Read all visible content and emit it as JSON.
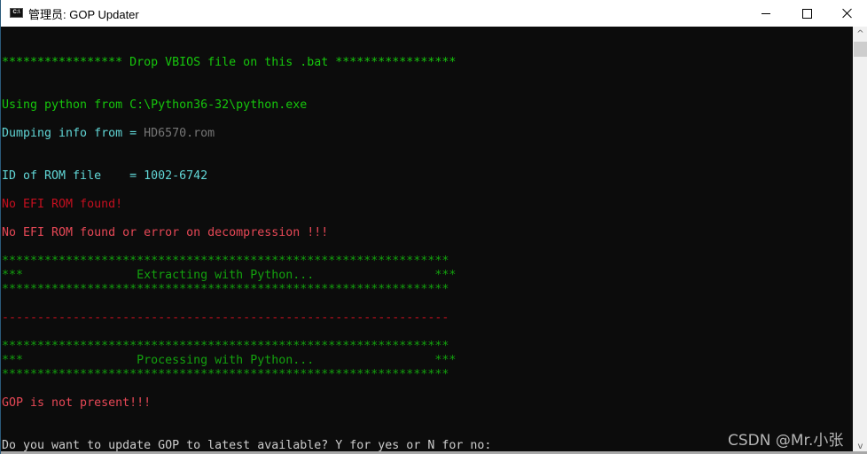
{
  "window": {
    "title": "管理员:  GOP Updater",
    "icon": "console-icon",
    "icon_text": "C:\\",
    "controls": {
      "minimize": "minimize-icon",
      "maximize": "maximize-icon",
      "close": "close-icon"
    }
  },
  "console": {
    "lines": [
      {
        "text": "***************** Drop VBIOS file on this .bat *****************",
        "color": "green-bright"
      },
      {
        "text": "Using python from C:\\Python36-32\\python.exe",
        "color": "green-bright"
      },
      {
        "text_label": "Dumping info from = ",
        "text_value": "HD6570.rom"
      },
      {
        "text": "ID of ROM file    = 1002-6742",
        "color": "cyan"
      },
      {
        "text": "No EFI ROM found!",
        "color": "darkred"
      },
      {
        "text": "No EFI ROM found or error on decompression !!!",
        "color": "red"
      },
      {
        "text": "***************************************************************",
        "color": "green"
      },
      {
        "text": "***                Extracting with Python...                 ***",
        "color": "green"
      },
      {
        "text": "***************************************************************",
        "color": "green"
      },
      {
        "text": "---------------------------------------------------------------",
        "color": "darkred"
      },
      {
        "text": "***************************************************************",
        "color": "green"
      },
      {
        "text": "***                Processing with Python...                 ***",
        "color": "green"
      },
      {
        "text": "***************************************************************",
        "color": "green"
      },
      {
        "text": "GOP is not present!!!",
        "color": "red"
      },
      {
        "text": "Do you want to update GOP to latest available? Y for yes or N for no:",
        "color": "white"
      }
    ]
  },
  "scrollbar": {
    "up_icon": "^",
    "down_icon": "v"
  },
  "watermark": "CSDN @Mr.小张"
}
